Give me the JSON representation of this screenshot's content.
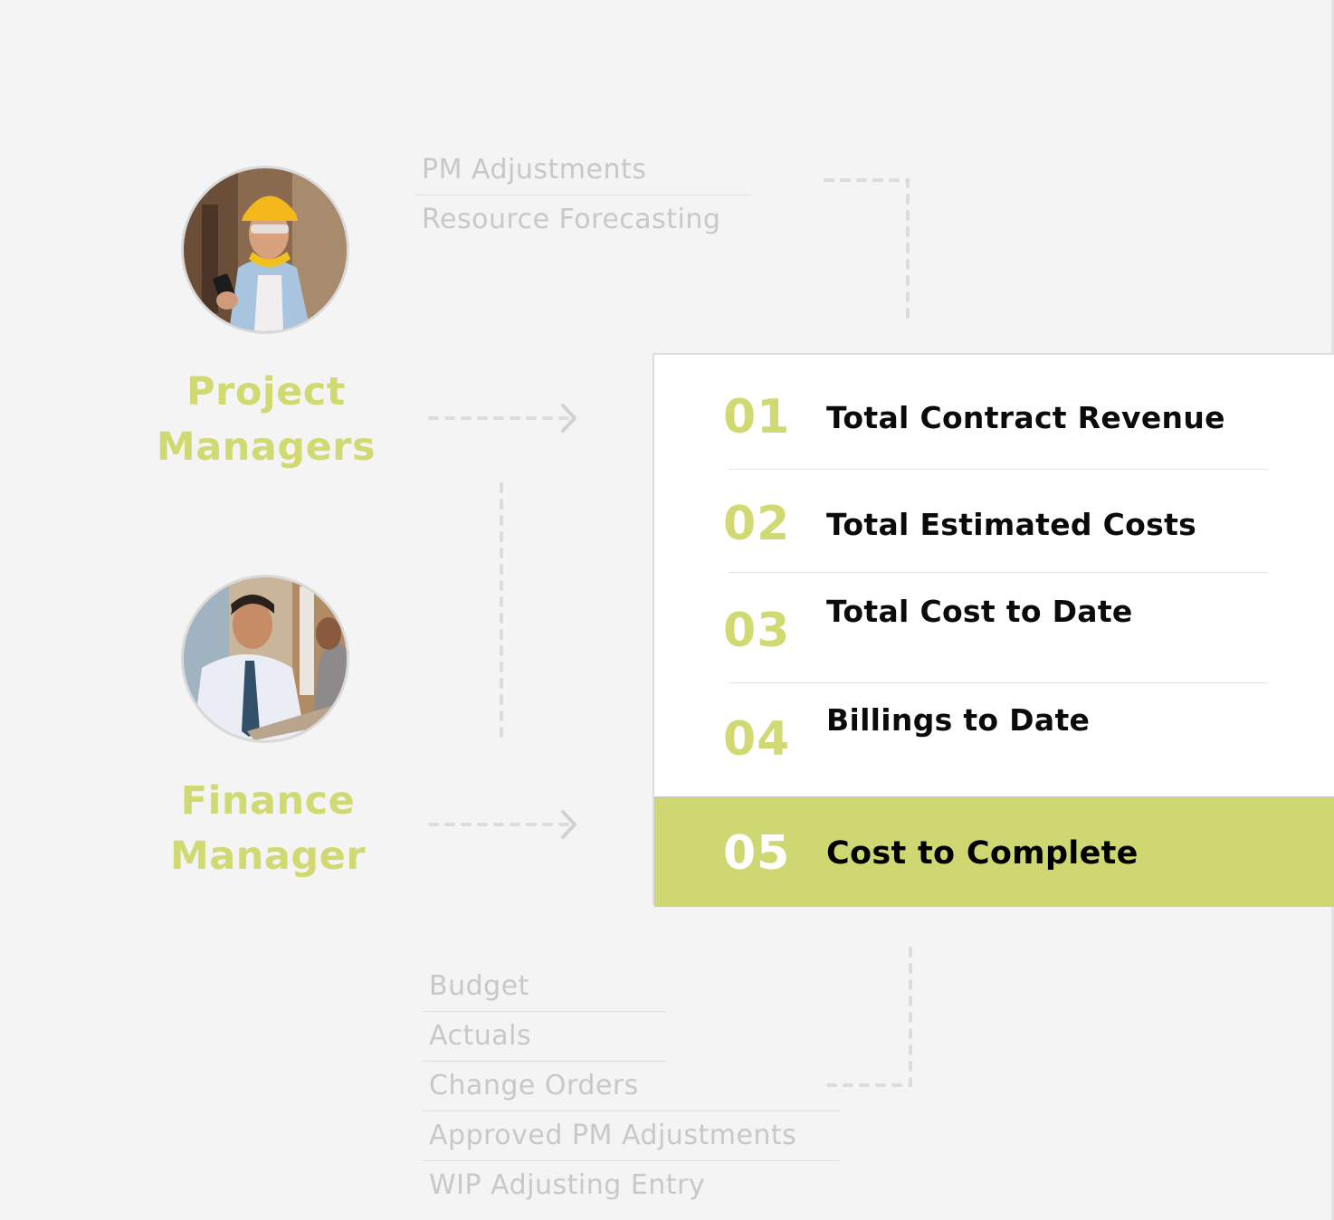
{
  "colors": {
    "accent": "#d1d972",
    "highlight_bg": "#cfd773",
    "muted_text": "#c8c8c8",
    "connector": "#dcdcdc",
    "background": "#f4f4f4"
  },
  "roles": [
    {
      "name": "Project Managers",
      "title_lines": [
        "Project",
        "Managers"
      ],
      "avatar_icon": "construction-worker-photo"
    },
    {
      "name": "Finance Manager",
      "title_lines": [
        "Finance",
        "Manager"
      ],
      "avatar_icon": "businessman-photo"
    }
  ],
  "pm_inputs": [
    "PM Adjustments",
    "Resource Forecasting"
  ],
  "finance_inputs": [
    "Budget",
    "Actuals",
    "Change Orders",
    "Approved PM Adjustments",
    "WIP Adjusting Entry"
  ],
  "metrics": [
    {
      "number": "01",
      "label": "Total Contract Revenue"
    },
    {
      "number": "02",
      "label": "Total Estimated Costs"
    },
    {
      "number": "03",
      "label": "Total Cost to Date"
    },
    {
      "number": "04",
      "label": "Billings to Date"
    },
    {
      "number": "05",
      "label": "Cost to Complete",
      "highlighted": true
    }
  ]
}
